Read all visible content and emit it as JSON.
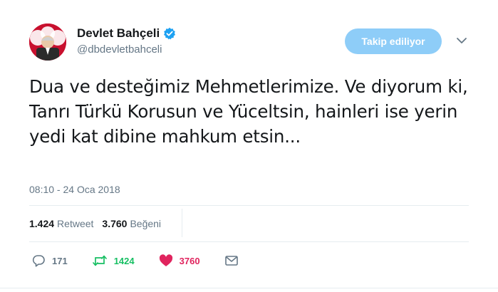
{
  "user": {
    "display_name": "Devlet Bahçeli",
    "handle": "@dbdevletbahceli",
    "verified": true
  },
  "follow_button": {
    "label": "Takip ediliyor"
  },
  "tweet": {
    "text": "Dua ve desteğimiz Mehmetlerimize. Ve diyorum ki, Tanrı Türkü Korusun ve Yüceltsin, hainleri ise yerin yedi kat dibine mahkum etsin...",
    "timestamp": "08:10 - 24 Oca 2018"
  },
  "stats": {
    "retweets": {
      "count": "1.424",
      "label": "Retweet"
    },
    "likes": {
      "count": "3.760",
      "label": "Beğeni"
    }
  },
  "actions": {
    "reply_count": "171",
    "retweet_count": "1424",
    "like_count": "3760"
  },
  "colors": {
    "follow_button": "#8ecdf8",
    "verified": "#1da1f2",
    "retweet": "#17bf63",
    "like": "#e0245e",
    "secondary_text": "#657786"
  },
  "icons": [
    "verified-badge-icon",
    "caret-down-icon",
    "reply-icon",
    "retweet-icon",
    "heart-icon",
    "message-icon"
  ]
}
